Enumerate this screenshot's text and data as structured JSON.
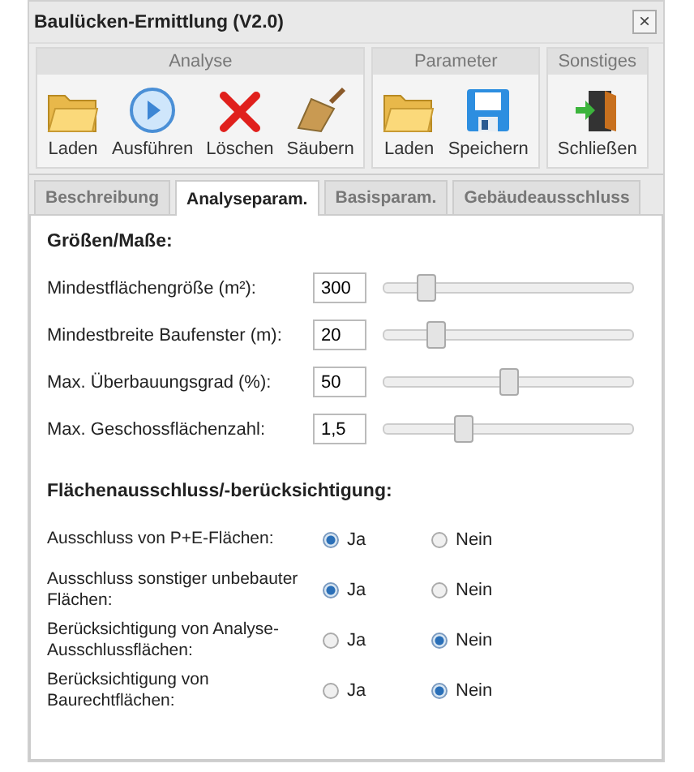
{
  "window": {
    "title": "Baulücken-Ermittlung (V2.0)",
    "close": "×"
  },
  "toolbar": [
    {
      "title": "Analyse",
      "buttons": [
        {
          "label": "Laden",
          "kind": "folder"
        },
        {
          "label": "Ausführen",
          "kind": "play"
        },
        {
          "label": "Löschen",
          "kind": "delete"
        },
        {
          "label": "Säubern",
          "kind": "broom"
        }
      ]
    },
    {
      "title": "Parameter",
      "buttons": [
        {
          "label": "Laden",
          "kind": "folder"
        },
        {
          "label": "Speichern",
          "kind": "save"
        }
      ]
    },
    {
      "title": "Sonstiges",
      "buttons": [
        {
          "label": "Schließen",
          "kind": "exit"
        }
      ]
    }
  ],
  "tabs": [
    {
      "label": "Beschreibung",
      "selected": false
    },
    {
      "label": "Analyseparam.",
      "selected": true
    },
    {
      "label": "Basisparam.",
      "selected": false
    },
    {
      "label": "Gebäudeausschluss",
      "selected": false
    }
  ],
  "sizes": {
    "heading": "Größen/Maße:",
    "rows": [
      {
        "label": "Mindestflächengröße (m²):",
        "value": "300",
        "level": 0.17
      },
      {
        "label": "Mindestbreite Baufenster (m):",
        "value": "20",
        "level": 0.21
      },
      {
        "label": "Max. Überbauungsgrad (%):",
        "value": "50",
        "level": 0.5
      },
      {
        "label": "Max. Geschossflächenzahl:",
        "value": "1,5",
        "level": 0.32
      }
    ]
  },
  "exclusion": {
    "heading": "Flächenausschluss/-berücksichtigung:",
    "rows": [
      {
        "label": "Ausschluss von P+E-Flächen:",
        "options": [
          {
            "label": "Ja",
            "selected": true
          },
          {
            "label": "Nein",
            "selected": false
          }
        ]
      },
      {
        "label": "Ausschluss sonstiger unbebauter Flächen:",
        "options": [
          {
            "label": "Ja",
            "selected": true
          },
          {
            "label": "Nein",
            "selected": false
          }
        ]
      },
      {
        "label": "Berücksichtigung von Analyse-Ausschlussflächen:",
        "options": [
          {
            "label": "Ja",
            "selected": false
          },
          {
            "label": "Nein",
            "selected": true
          }
        ]
      },
      {
        "label": "Berücksichtigung von Baurechtflächen:",
        "options": [
          {
            "label": "Ja",
            "selected": false
          },
          {
            "label": "Nein",
            "selected": true
          }
        ]
      }
    ]
  }
}
